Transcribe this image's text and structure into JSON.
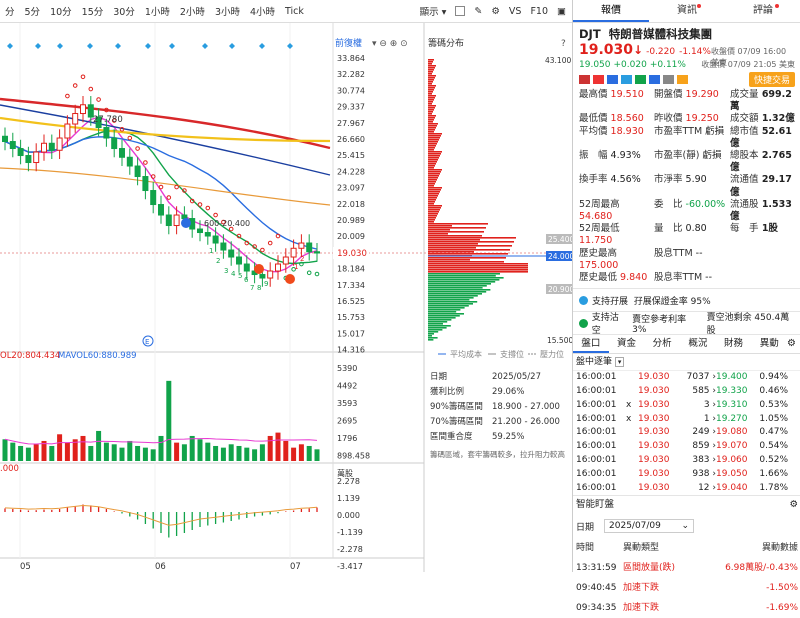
{
  "toolbar": {
    "timeframes": [
      "5分",
      "10分",
      "15分",
      "30分",
      "1小時",
      "2小時",
      "3小時",
      "4小時",
      "Tick"
    ],
    "first_partial": "分",
    "display": "顯示",
    "vs": "VS",
    "f10": "F10"
  },
  "chart": {
    "adjust": "前復權",
    "price_axis": [
      "33.864",
      "32.282",
      "30.774",
      "29.337",
      "27.967",
      "26.660",
      "25.415",
      "24.228",
      "23.097",
      "22.018",
      "20.989",
      "20.009",
      "19.030",
      "18.184",
      "17.334",
      "16.525",
      "15.753",
      "15.017",
      "14.316"
    ],
    "current_price": "19.030",
    "high_label": "27.780",
    "arrow_label": "600-20.400",
    "rebased_e": "E",
    "vol_legend": "OL20:804.434",
    "vol_legend_full": "MAVOL60:880.989",
    "vol_axis": [
      "5390",
      "4492",
      "3593",
      "2695",
      "1796",
      "898.458",
      "萬股"
    ],
    "macd_axis": [
      "2.278",
      "1.139",
      "0.000",
      "-1.139",
      "-2.278",
      "-3.417"
    ],
    "macd_left": ".000",
    "dates": [
      "05",
      "06",
      "07"
    ],
    "count_labels": [
      "1",
      "2",
      "3",
      "4",
      "5",
      "6",
      "7",
      "8",
      "9",
      "1",
      "2"
    ]
  },
  "dist": {
    "title": "籌碼分布",
    "top_price": "43.100",
    "bottom_price": "15.500",
    "p1": "25.400",
    "p2": "24.000",
    "p3": "20.900",
    "legend": [
      "平均成本",
      "支撐位",
      "壓力位"
    ],
    "info": [
      [
        "日期",
        "2025/05/27"
      ],
      [
        "獲利比例",
        "29.06%"
      ],
      [
        "90%籌碼區間",
        "18.900 - 27.000"
      ],
      [
        "70%籌碼區間",
        "21.200 - 26.000"
      ],
      [
        "區間重合度",
        "59.25%"
      ]
    ],
    "note": "籌碼區域，套牢籌碼較多，拉升阻力較高"
  },
  "right": {
    "tabs": [
      "報價",
      "資訊",
      "評論"
    ],
    "ticker": "DJT",
    "name": "特朗普媒體科技集團",
    "price": "19.030",
    "arrow": "↓",
    "change": "-0.220",
    "pct": "-1.14%",
    "close_time": "收盤價 07/09 16:00 美東",
    "after_price": "19.050",
    "after_change": "+0.020",
    "after_pct": "+0.11%",
    "after_time": "收盤價 07/09 21:05 美東",
    "quick_trade": "快捷交易",
    "q": [
      [
        "最高價",
        "19.510",
        "開盤價",
        "19.290",
        "成交量",
        "699.2萬"
      ],
      [
        "最低價",
        "18.560",
        "昨收價",
        "19.250",
        "成交額",
        "1.32億"
      ],
      [
        "平均價",
        "18.930",
        "市盈率TTM",
        "虧損",
        "總市值",
        "52.61億"
      ],
      [
        "振　幅",
        "4.93%",
        "市盈率(靜)",
        "虧損",
        "總股本",
        "2.765億"
      ],
      [
        "換手率",
        "4.56%",
        "市淨率",
        "5.90",
        "流通值",
        "29.17億"
      ],
      [
        "52周最高",
        "54.680",
        "委　比",
        "-60.00%",
        "流通股",
        "1.533億"
      ],
      [
        "52周最低",
        "11.750",
        "量　比",
        "0.80",
        "每　手",
        "1股"
      ],
      [
        "歷史最高",
        "175.000",
        "股息TTM",
        "--",
        "",
        ""
      ],
      [
        "歷史最低",
        "9.840",
        "股息率TTM",
        "--",
        "",
        ""
      ]
    ],
    "support1": "支持孖展",
    "support1b": "孖展保證金率 95%",
    "support2": "支持沽空",
    "support2b": "賣空參考利率 3%",
    "support2c": "賣空池剩余 450.4萬股",
    "subtabs": [
      "盤口",
      "資金",
      "分析",
      "概況",
      "財務",
      "異動"
    ],
    "detail_title": "盤中逐筆",
    "ticks": [
      [
        "16:00:01",
        "19.030",
        "7037",
        "19.400",
        "0.94%"
      ],
      [
        "16:00:01",
        "19.030",
        "585",
        "19.330",
        "0.46%"
      ],
      [
        "16:00:01",
        "19.030",
        "3",
        "19.310",
        "0.53%"
      ],
      [
        "16:00:01",
        "19.030",
        "1",
        "19.270",
        "1.05%"
      ],
      [
        "16:00:01",
        "19.030",
        "249",
        "19.080",
        "0.47%"
      ],
      [
        "16:00:01",
        "19.030",
        "859",
        "19.070",
        "0.54%"
      ],
      [
        "16:00:01",
        "19.030",
        "383",
        "19.060",
        "0.52%"
      ],
      [
        "16:00:01",
        "19.030",
        "938",
        "19.050",
        "1.66%"
      ],
      [
        "16:00:01",
        "19.030",
        "12",
        "19.040",
        "1.78%"
      ]
    ],
    "smart_title": "智能盯盤",
    "date_label": "日期",
    "date_value": "2025/07/09",
    "cols": [
      "時間",
      "異動類型",
      "異動數據"
    ],
    "alerts": [
      [
        "13:31:59",
        "區間放量(跌)",
        "6.98萬股/-0.43%"
      ],
      [
        "09:40:45",
        "加速下跌",
        "-1.50%"
      ],
      [
        "09:34:35",
        "加速下跌",
        "-1.69%"
      ]
    ]
  },
  "chart_data": {
    "type": "candlestick",
    "note_series": [
      "MA lines",
      "MAVOL20",
      "MAVOL60",
      "MACD"
    ],
    "closes": [
      25.4,
      25.0,
      24.6,
      24.2,
      24.8,
      25.3,
      24.9,
      25.6,
      26.4,
      27.0,
      27.5,
      26.8,
      26.2,
      25.6,
      25.0,
      24.5,
      24.0,
      23.4,
      22.6,
      21.8,
      21.2,
      20.6,
      21.2,
      21.0,
      20.4,
      20.2,
      20.0,
      19.6,
      19.2,
      18.8,
      18.4,
      18.0,
      17.8,
      17.6,
      18.0,
      18.4,
      18.8,
      19.3,
      19.6,
      19.1,
      19.03
    ],
    "volumes": [
      1300,
      1100,
      900,
      800,
      1000,
      1200,
      900,
      1600,
      1100,
      1300,
      1500,
      900,
      1800,
      1100,
      1000,
      800,
      1200,
      900,
      800,
      700,
      1500,
      4800,
      1100,
      1000,
      1500,
      1300,
      1100,
      900,
      800,
      1000,
      900,
      800,
      700,
      1000,
      1500,
      1700,
      1200,
      800,
      1000,
      900,
      699
    ],
    "macd": [
      0.12,
      0.1,
      0.08,
      0.05,
      0.06,
      0.08,
      0.07,
      0.1,
      0.15,
      0.2,
      0.25,
      0.22,
      0.18,
      0.1,
      0.02,
      -0.05,
      -0.15,
      -0.25,
      -0.4,
      -0.55,
      -0.7,
      -0.85,
      -0.8,
      -0.7,
      -0.6,
      -0.5,
      -0.45,
      -0.4,
      -0.35,
      -0.3,
      -0.25,
      -0.2,
      -0.15,
      -0.12,
      -0.08,
      -0.04,
      0.02,
      0.05,
      0.1,
      0.12,
      0.15
    ]
  }
}
